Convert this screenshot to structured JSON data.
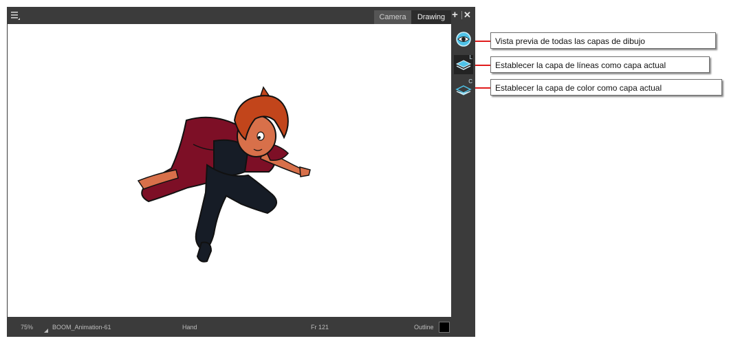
{
  "window": {
    "menu_icon": "hamburger-menu-icon",
    "tabs": [
      {
        "label": "Camera",
        "active": false
      },
      {
        "label": "Drawing",
        "active": true
      }
    ],
    "add_icon": "plus-icon",
    "close_icon": "close-icon"
  },
  "toolbar": {
    "buttons": [
      {
        "icon": "eye-icon",
        "letter": "",
        "active": false
      },
      {
        "icon": "layers-icon",
        "letter": "L",
        "active": true
      },
      {
        "icon": "layers-icon",
        "letter": "C",
        "active": false
      }
    ]
  },
  "callouts": [
    "Vista previa de todas las capas de dibujo",
    "Establecer la capa de líneas como capa actual",
    "Establecer la capa de color como capa actual"
  ],
  "status": {
    "zoom": "75%",
    "drawing_name": "BOOM_Animation-61",
    "tool": "Hand",
    "frame": "Fr 121",
    "view_mode": "Outline"
  },
  "colors": {
    "accent_callout_line": "#e01b1b",
    "panel_bg": "#3b3b3b",
    "icon_blue": "#4fc3e8"
  }
}
